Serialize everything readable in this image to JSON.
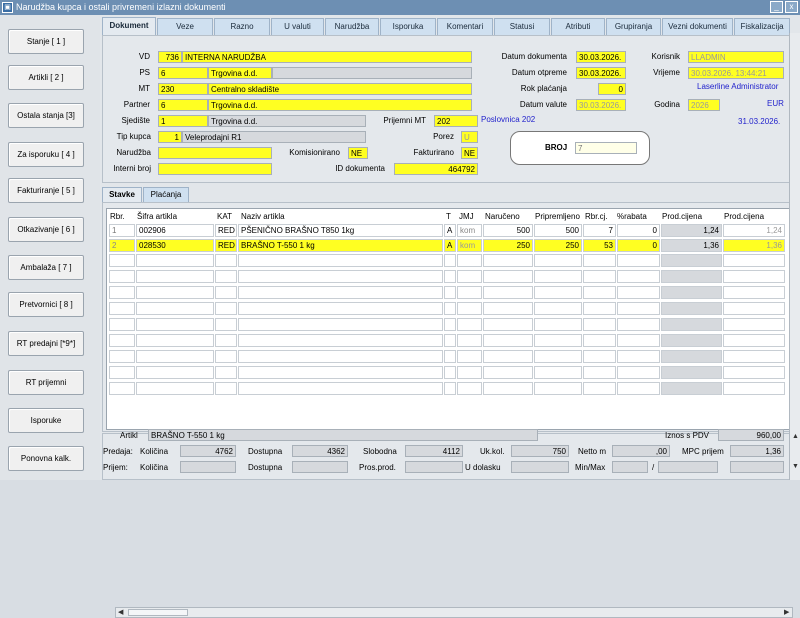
{
  "window": {
    "title": "Narudžba kupca i ostali privremeni izlazni dokumenti",
    "min": "_",
    "close": "x"
  },
  "side_buttons": [
    "Stanje [ 1 ]",
    "Artikli [ 2 ]",
    "Ostala stanja [3]",
    "Za isporuku [ 4 ]",
    "Fakturiranje [ 5 ]",
    "Otkazivanje [ 6 ]",
    "Ambalaža [ 7 ]",
    "Pretvornici [ 8 ]",
    "RT predajni [*9*]",
    "RT prijemni",
    "Isporuke",
    "Ponovna kalk."
  ],
  "tabs": [
    "Dokument",
    "Veze",
    "Razno",
    "U valuti",
    "Narudžba",
    "Isporuka",
    "Komentari",
    "Statusi",
    "Atributi",
    "Grupiranja",
    "Vezni dokumenti",
    "Fiskalizacija"
  ],
  "form": {
    "vd_label": "VD",
    "vd_code": "736",
    "vd_name": "INTERNA NARUDŽBA",
    "ps_label": "PS",
    "ps_code": "6",
    "ps_name": "Trgovina d.d.",
    "mt_label": "MT",
    "mt_code": "230",
    "mt_name": "Centralno skladište",
    "partner_label": "Partner",
    "partner_code": "6",
    "partner_name": "Trgovina d.d.",
    "sjediste_label": "Sjedište",
    "sjediste_code": "1",
    "sjediste_name": "Trgovina d.d.",
    "prijemni_mt_label": "Prijemni MT",
    "prijemni_mt": "202",
    "prijemni_mt_name": "Poslovnica 202",
    "tip_kupca_label": "Tip kupca",
    "tip_kupca_code": "1",
    "tip_kupca_name": "Veleprodajni R1",
    "porez_label": "Porez",
    "porez": "U",
    "narudzba_label": "Narudžba",
    "narudzba": "",
    "komisionirano_label": "Komisionirano",
    "komisionirano": "NE",
    "fakturirano_label": "Fakturirano",
    "fakturirano": "NE",
    "interni_broj_label": "Interni broj",
    "interni_broj": "",
    "id_dok_label": "ID dokumenta",
    "id_dok": "464792",
    "datum_dok_label": "Datum dokumenta",
    "datum_dok": "30.03.2026.",
    "datum_otp_label": "Datum otpreme",
    "datum_otp": "30.03.2026.",
    "rok_label": "Rok plaćanja",
    "rok": "0",
    "datum_val_label": "Datum valute",
    "datum_val": "30.03.2026.",
    "korisnik_label": "Korisnik",
    "korisnik": "LLADMIN",
    "vrijeme_label": "Vrijeme",
    "vrijeme": "30.03.2026. 13:44:21",
    "admin_name": "Laserline Administrator",
    "godina_label": "Godina",
    "godina": "2026",
    "valuta": "EUR",
    "date_display": "31.03.2026.",
    "broj_label": "BROJ",
    "broj": "7"
  },
  "subtabs": [
    "Stavke",
    "Plaćanja"
  ],
  "grid": {
    "headers": [
      "Rbr.",
      "Šifra artikla",
      "KAT",
      "Naziv artikla",
      "T",
      "JMJ",
      "Naručeno",
      "Pripremljeno",
      "Rbr.cj.",
      "%rabata",
      "Prod.cijena",
      "Prod.cijena"
    ],
    "rows": [
      [
        "1",
        "002906",
        "RED",
        "PŠENIČNO BRAŠNO T850 1kg",
        "A",
        "kom",
        "500",
        "500",
        "7",
        "0",
        "1,24",
        "1,24"
      ],
      [
        "2",
        "028530",
        "RED",
        "BRAŠNO T-550 1 kg",
        "A",
        "kom",
        "250",
        "250",
        "53",
        "0",
        "1,36",
        "1,36"
      ]
    ]
  },
  "bottom": {
    "artikl_label": "Artikl",
    "artikl": "BRAŠNO T-550 1 kg",
    "iznos_label": "Iznos s PDV",
    "iznos": "960,00",
    "predaja_label": "Predaja:",
    "kolicina_label": "Količina",
    "kolicina": "4762",
    "dostupna_label": "Dostupna",
    "dostupna": "4362",
    "slobodna_label": "Slobodna",
    "slobodna": "4112",
    "ukkol_label": "Uk.kol.",
    "ukkol": "750",
    "netto_label": "Netto m",
    "netto": ",00",
    "mpc_label": "MPC prijem",
    "mpc": "1,36",
    "prijem_label": "Prijem:",
    "kolicina2_label": "Količina",
    "dostupna2_label": "Dostupna",
    "prosprod_label": "Pros.prod.",
    "udolasku_label": "U dolasku",
    "minmax_label": "Min/Max",
    "slash": "/"
  }
}
